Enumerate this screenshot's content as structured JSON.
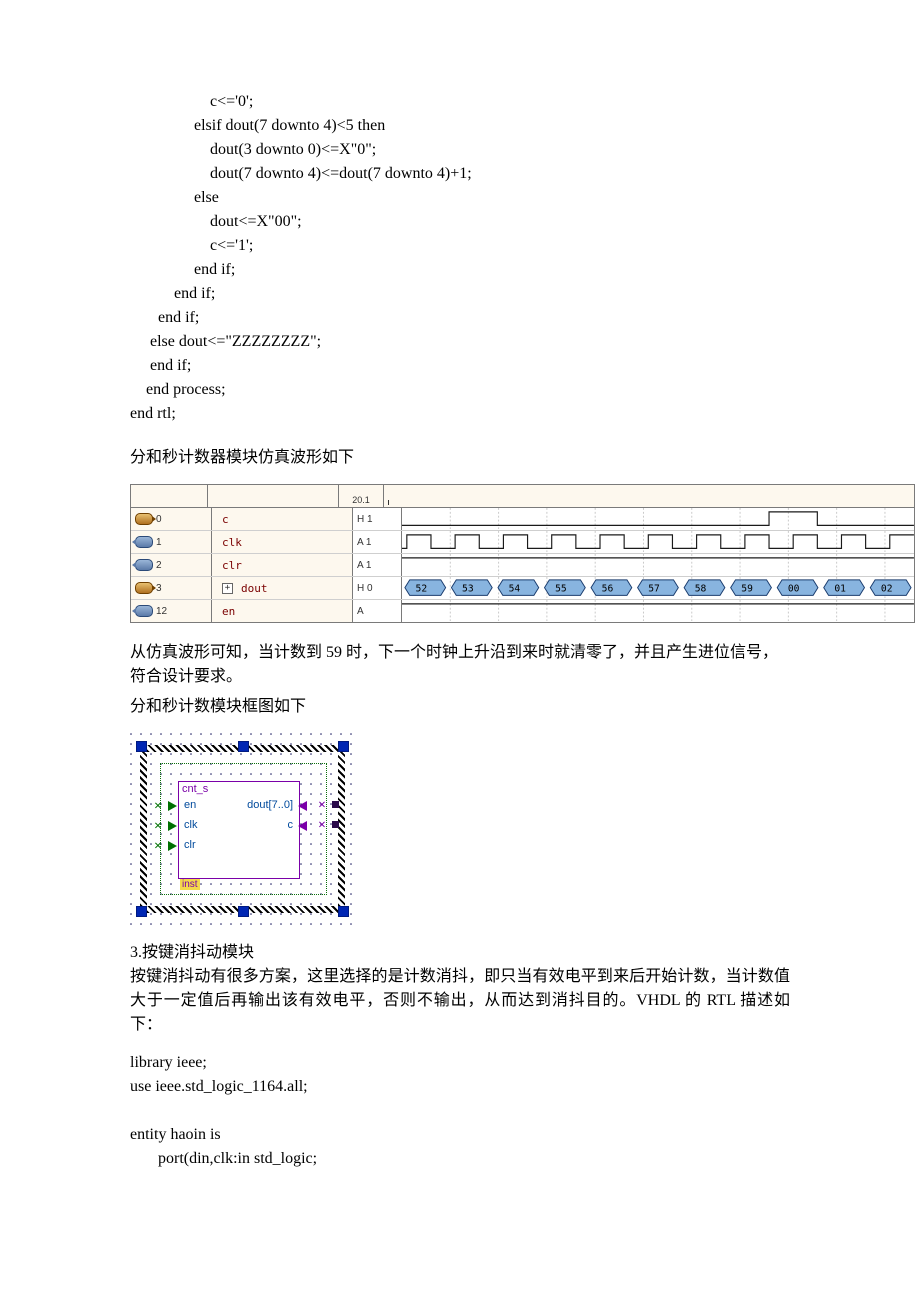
{
  "code_top": "                    c<='0';\n                elsif dout(7 downto 4)<5 then\n                    dout(3 downto 0)<=X\"0\";\n                    dout(7 downto 4)<=dout(7 downto 4)+1;\n                else\n                    dout<=X\"00\";\n                    c<='1';\n                end if;\n           end if;\n       end if;\n     else dout<=\"ZZZZZZZZ\";\n     end if;\n    end process;\nend rtl;",
  "para1": "分和秒计数器模块仿真波形如下",
  "waveform": {
    "header_time": "20.1",
    "signals": [
      {
        "icon": "out",
        "idx": "0",
        "expand": false,
        "name": "c",
        "val": "H 1"
      },
      {
        "icon": "in",
        "idx": "1",
        "expand": false,
        "name": "clk",
        "val": "A 1"
      },
      {
        "icon": "in",
        "idx": "2",
        "expand": false,
        "name": "clr",
        "val": "A 1"
      },
      {
        "icon": "out",
        "idx": "3",
        "expand": true,
        "name": "dout",
        "val": "H 0"
      },
      {
        "icon": "in",
        "idx": "12",
        "expand": false,
        "name": "en",
        "val": "A"
      }
    ],
    "bus_values": [
      "52",
      "53",
      "54",
      "55",
      "56",
      "57",
      "58",
      "59",
      "00",
      "01",
      "02"
    ]
  },
  "para2": "从仿真波形可知，当计数到 59 时，下一个时钟上升沿到来时就清零了，并且产生进位信号，符合设计要求。",
  "para3": "分和秒计数模块框图如下",
  "block": {
    "entity": "cnt_s",
    "ports_in": [
      "en",
      "clk",
      "clr"
    ],
    "ports_out": [
      "dout[7..0]",
      "c"
    ],
    "inst": "inst"
  },
  "section3_title": "3.按键消抖动模块",
  "section3_body": "按键消抖动有很多方案，这里选择的是计数消抖，即只当有效电平到来后开始计数，当计数值大于一定值后再输出该有效电平，否则不输出，从而达到消抖目的。VHDL 的 RTL 描述如下：",
  "code_bottom": "library ieee;\nuse ieee.std_logic_1164.all;\n\nentity haoin is\n       port(din,clk:in std_logic;",
  "chart_data": {
    "type": "table",
    "title": "VHDL simulation waveform signals",
    "categories": [
      "c",
      "clk",
      "clr",
      "dout",
      "en"
    ],
    "values": [
      {
        "signal": "c",
        "type": "output",
        "pattern": "low until dout=59 then high for one cycle"
      },
      {
        "signal": "clk",
        "type": "input",
        "pattern": "periodic clock"
      },
      {
        "signal": "clr",
        "type": "input",
        "pattern": "constant high"
      },
      {
        "signal": "dout",
        "type": "output bus",
        "sequence": [
          "52",
          "53",
          "54",
          "55",
          "56",
          "57",
          "58",
          "59",
          "00",
          "01",
          "02"
        ]
      },
      {
        "signal": "en",
        "type": "input",
        "pattern": "constant high"
      }
    ]
  }
}
